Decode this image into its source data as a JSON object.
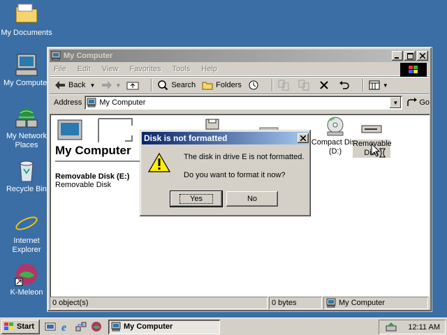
{
  "desktop": {
    "icons": [
      {
        "label": "My Documents"
      },
      {
        "label": "My Computer"
      },
      {
        "label": "My Network Places"
      },
      {
        "label": "Recycle Bin"
      },
      {
        "label": "Internet Explorer"
      },
      {
        "label": "K-Meleon"
      }
    ]
  },
  "window": {
    "title": "My Computer",
    "menu": [
      "File",
      "Edit",
      "View",
      "Favorites",
      "Tools",
      "Help"
    ],
    "toolbar": {
      "back": "Back",
      "search": "Search",
      "folders": "Folders"
    },
    "address": {
      "label": "Address",
      "value": "My Computer",
      "go": "Go"
    },
    "panel": {
      "heading": "My Computer",
      "item_title": "Removable Disk (E:)",
      "item_subtitle": "Removable Disk"
    },
    "content_icons": [
      {
        "label": "Compact Disc (D:)"
      },
      {
        "label": "Removable Disk"
      }
    ],
    "status": {
      "objects": "0 object(s)",
      "size": "0 bytes",
      "zone": "My Computer"
    }
  },
  "dialog": {
    "title": "Disk is not formatted",
    "message": "The disk in drive E is not formatted.",
    "question": "Do you want to format it now?",
    "yes": "Yes",
    "no": "No"
  },
  "taskbar": {
    "start": "Start",
    "task": "My Computer",
    "clock": "12:11 AM"
  },
  "colors": {
    "desktop": "#3a6ea5",
    "window_face": "#d4d0c8",
    "active_title": "#0a246a",
    "inactive_title": "#808080"
  }
}
